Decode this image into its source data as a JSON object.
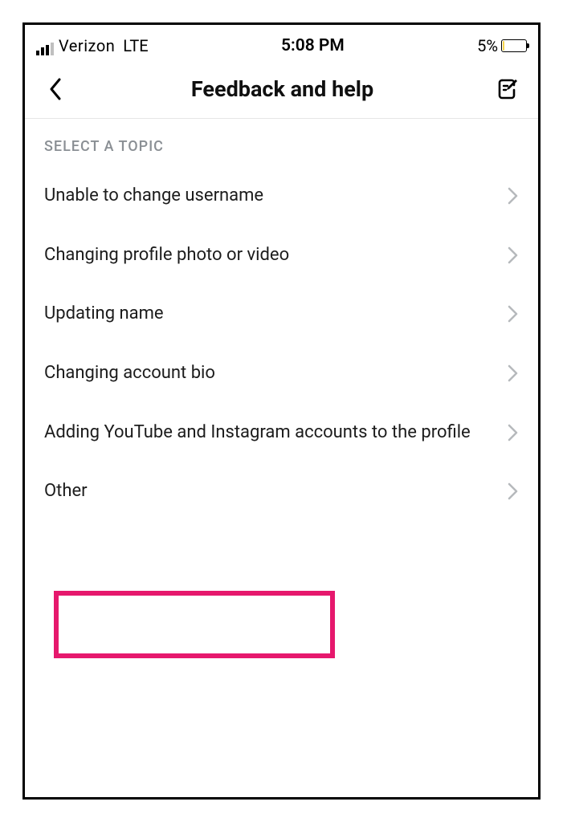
{
  "status": {
    "carrier": "Verizon",
    "network": "LTE",
    "time": "5:08 PM",
    "battery_percent": "5%"
  },
  "header": {
    "title": "Feedback and help"
  },
  "section_header": "SELECT A TOPIC",
  "topics": [
    {
      "label": "Unable to change username"
    },
    {
      "label": "Changing profile photo or video"
    },
    {
      "label": "Updating name"
    },
    {
      "label": "Changing account bio"
    },
    {
      "label": "Adding YouTube and Instagram accounts to the profile"
    },
    {
      "label": "Other"
    }
  ],
  "highlighted_topic_index": 5
}
